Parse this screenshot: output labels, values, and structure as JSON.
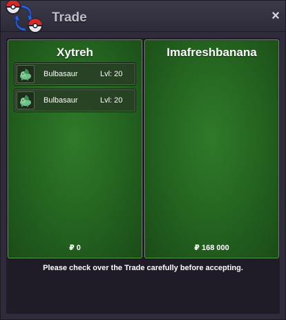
{
  "window": {
    "title": "Trade",
    "close_label": "×"
  },
  "left_player": {
    "name": "Xytreh",
    "pokemon": [
      {
        "name": "Bulbasaur",
        "level": "Lvl: 20",
        "icon": "bulbasaur-icon"
      },
      {
        "name": "Bulbasaur",
        "level": "Lvl: 20",
        "icon": "bulbasaur-icon"
      }
    ],
    "money": "₽ 0"
  },
  "right_player": {
    "name": "Imafreshbanana",
    "pokemon": [],
    "money": "₽ 168 000"
  },
  "notice": "Please check over the Trade carefully before accepting.",
  "colors": {
    "panel_green": "#2f7a2a",
    "panel_border": "#5fa24a",
    "window_bg": "#2f2b3a"
  }
}
